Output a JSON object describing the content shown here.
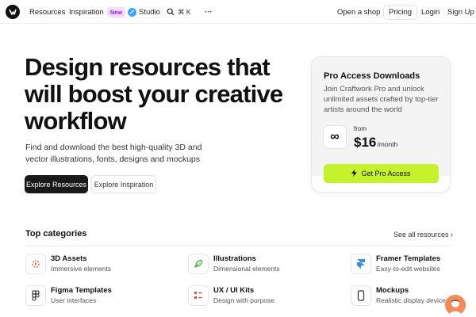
{
  "nav": {
    "items": [
      {
        "label": "Resources"
      },
      {
        "label": "Inspiration",
        "badge": "New"
      },
      {
        "label": "Studio"
      },
      {
        "shortcut": "⌘ K"
      },
      {
        "label": "···"
      }
    ],
    "right": {
      "open_shop": "Open a shop",
      "pricing": "Pricing",
      "login": "Login",
      "signup": "Sign Up"
    }
  },
  "hero": {
    "title": "Design resources that will boost your creative workflow",
    "subtitle": "Find and download the best high-quality 3D and vector illustrations, fonts, designs and mockups",
    "primary_button": "Explore Resources",
    "secondary_button": "Explore Inspiration"
  },
  "pro": {
    "title": "Pro Access Downloads",
    "description": "Join Craftwork Pro and unlock unlimited assets crafted by top-tier artists around the world",
    "icon_glyph": "∞",
    "from_label": "from",
    "price": "$16",
    "per": "/month",
    "button": "Get Pro Access",
    "accent": "#c6f22b"
  },
  "categories": {
    "heading": "Top categories",
    "see_all": "See all resources ›",
    "items": [
      {
        "title": "3D Assets",
        "subtitle": "Immersive elements",
        "icon": "3d-assets-icon",
        "color": "#e8663d"
      },
      {
        "title": "Illustrations",
        "subtitle": "Dimensional elements",
        "icon": "illustrations-icon",
        "color": "#46b35a"
      },
      {
        "title": "Framer Templates",
        "subtitle": "Easy-to-edit websites",
        "icon": "framer-icon",
        "color": "#2f8ee8"
      },
      {
        "title": "Figma Templates",
        "subtitle": "User interfaces",
        "icon": "figma-icon",
        "color": "#222222"
      },
      {
        "title": "UX / UI Kits",
        "subtitle": "Design with purpose",
        "icon": "ui-kits-icon",
        "color": "#e3443d"
      },
      {
        "title": "Mockups",
        "subtitle": "Realistic display devices",
        "icon": "mockups-icon",
        "color": "#333333"
      }
    ]
  }
}
